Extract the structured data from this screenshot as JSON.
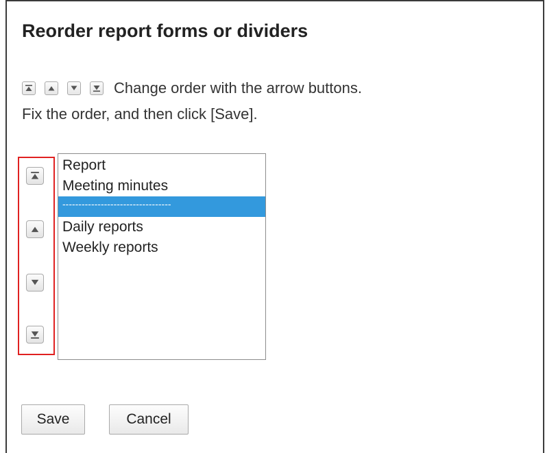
{
  "page": {
    "title": "Reorder report forms or dividers"
  },
  "instructions": {
    "line1": "Change order with the arrow buttons.",
    "line2": "Fix the order, and then click [Save]."
  },
  "order_controls": {
    "icons": [
      "move-to-top-icon",
      "move-up-icon",
      "move-down-icon",
      "move-to-bottom-icon"
    ]
  },
  "list": {
    "items": [
      {
        "label": "Report",
        "selected": false
      },
      {
        "label": "Meeting minutes",
        "selected": false
      },
      {
        "label": "----------------------------------",
        "selected": true
      },
      {
        "label": "Daily reports",
        "selected": false
      },
      {
        "label": "Weekly reports",
        "selected": false
      }
    ]
  },
  "buttons": {
    "save_label": "Save",
    "cancel_label": "Cancel"
  },
  "colors": {
    "selection": "#3399dd",
    "highlight_border": "#e02020"
  }
}
